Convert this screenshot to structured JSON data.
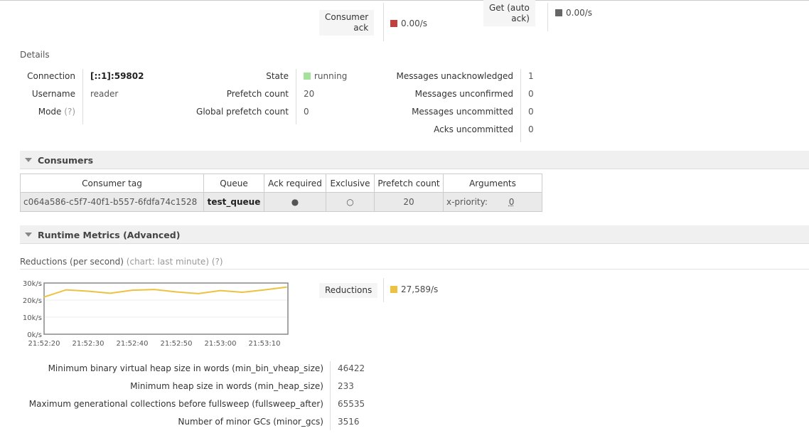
{
  "top_rates": [
    {
      "label": "Consumer ack",
      "label_lines": [
        "Consumer",
        "ack"
      ],
      "value": "0.00/s",
      "color": "#c0403f"
    },
    {
      "label": "Get (auto ack)",
      "label_lines": [
        "Get (auto",
        "ack)"
      ],
      "value": "0.00/s",
      "color": "#666666"
    }
  ],
  "details": {
    "heading": "Details",
    "col1": [
      {
        "key": "Connection",
        "value": "[::1]:59802"
      },
      {
        "key": "Username",
        "value": "reader"
      },
      {
        "key": "Mode",
        "hint": "(?)",
        "value": ""
      }
    ],
    "col2": [
      {
        "key": "State",
        "value": "running",
        "status_color": "#a4e19a"
      },
      {
        "key": "Prefetch count",
        "value": "20"
      },
      {
        "key": "Global prefetch count",
        "value": "0"
      }
    ],
    "col3": [
      {
        "key": "Messages unacknowledged",
        "value": "1"
      },
      {
        "key": "Messages unconfirmed",
        "value": "0"
      },
      {
        "key": "Messages uncommitted",
        "value": "0"
      },
      {
        "key": "Acks uncommitted",
        "value": "0"
      }
    ]
  },
  "consumers": {
    "title": "Consumers",
    "headers": [
      "Consumer tag",
      "Queue",
      "Ack required",
      "Exclusive",
      "Prefetch count",
      "Arguments"
    ],
    "rows": [
      {
        "tag": "c064a586-c5f7-40f1-b557-6fdfa74c1528",
        "queue": "test_queue",
        "ack_required": "●",
        "exclusive": "○",
        "prefetch": "20",
        "arg_key": "x-priority:",
        "arg_value": "0"
      }
    ]
  },
  "runtime": {
    "title": "Runtime Metrics (Advanced)",
    "reductions_heading": "Reductions (per second)",
    "reductions_note": "(chart: last minute)",
    "reductions_hint": "(?)",
    "legend_label": "Reductions",
    "legend_value": "27,589/s",
    "legend_color": "#edc240",
    "metrics": [
      {
        "key": "Minimum binary virtual heap size in words (min_bin_vheap_size)",
        "value": "46422"
      },
      {
        "key": "Minimum heap size in words (min_heap_size)",
        "value": "233"
      },
      {
        "key": "Maximum generational collections before fullsweep (fullsweep_after)",
        "value": "65535"
      },
      {
        "key": "Number of minor GCs (minor_gcs)",
        "value": "3516"
      }
    ]
  },
  "chart_data": {
    "type": "line",
    "title": "",
    "xlabel": "",
    "ylabel": "",
    "x_ticks": [
      "21:52:20",
      "21:52:30",
      "21:52:40",
      "21:52:50",
      "21:53:00",
      "21:53:10"
    ],
    "y_ticks": [
      "0k/s",
      "10k/s",
      "20k/s",
      "30k/s"
    ],
    "ylim": [
      0,
      30000
    ],
    "series": [
      {
        "color": "#edc240",
        "x": [
          "21:52:20",
          "21:52:25",
          "21:52:30",
          "21:52:35",
          "21:52:40",
          "21:52:45",
          "21:52:50",
          "21:52:55",
          "21:53:00",
          "21:53:05",
          "21:53:10",
          "21:53:15"
        ],
        "values": [
          21800,
          26000,
          25200,
          24000,
          25800,
          26200,
          24800,
          23800,
          25600,
          24600,
          26000,
          27589
        ]
      }
    ]
  }
}
